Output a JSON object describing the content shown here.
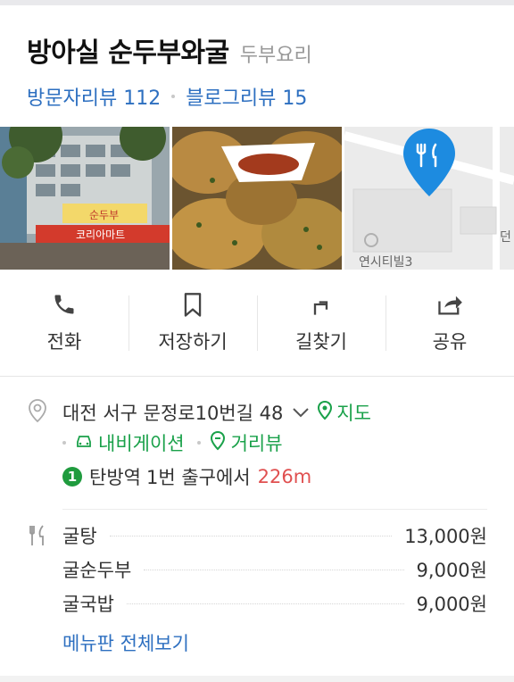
{
  "place": {
    "name": "방아실 순두부와굴",
    "category": "두부요리",
    "visitor_reviews": "방문자리뷰 112",
    "blog_reviews": "블로그리뷰 15"
  },
  "actions": [
    {
      "label": "전화",
      "icon": "phone-icon"
    },
    {
      "label": "저장하기",
      "icon": "bookmark-icon"
    },
    {
      "label": "길찾기",
      "icon": "directions-icon"
    },
    {
      "label": "공유",
      "icon": "share-icon"
    }
  ],
  "address": {
    "text": "대전 서구 문정로10번길 48",
    "map_label": "지도",
    "navigation_label": "내비게이션",
    "street_view_label": "거리뷰"
  },
  "subway": {
    "line": "1",
    "station": "탄방역",
    "exit": "1번 출구에서",
    "distance": "226m"
  },
  "menu": {
    "items": [
      {
        "name": "굴탕",
        "price": "13,000원"
      },
      {
        "name": "굴순두부",
        "price": "9,000원"
      },
      {
        "name": "굴국밥",
        "price": "9,000원"
      }
    ],
    "view_all": "메뉴판 전체보기"
  },
  "photo_text": {
    "map_label": "연시티빌3",
    "map_edge": "던",
    "sign1": "순두부",
    "sign2": "코리아마트"
  },
  "colors": {
    "link_blue": "#2d6fc0",
    "green": "#1aa14a",
    "distance_red": "#e05050",
    "map_pin": "#1d8be0"
  }
}
